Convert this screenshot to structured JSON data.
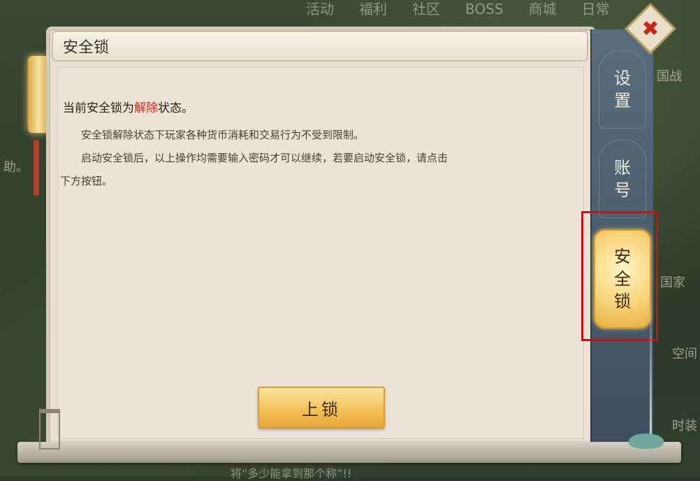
{
  "topnav": {
    "items": [
      "活动",
      "福利",
      "社区",
      "BOSS",
      "商城",
      "日常"
    ]
  },
  "background_labels": {
    "left": "助。",
    "right": [
      "国战",
      "国家",
      "空间",
      "时装"
    ]
  },
  "panel": {
    "title": "安全锁",
    "status_prefix": "当前安全锁为",
    "status_value": "解除",
    "status_suffix": "状态。",
    "paragraph1": "安全锁解除状态下玩家各种货币消耗和交易行为不受到限制。",
    "paragraph2": "启动安全锁后，以上操作均需要输入密码才可以继续，若要启动安全锁，请点击",
    "paragraph3": "下方按钮。",
    "lock_button": "上锁"
  },
  "tabs": [
    {
      "label_top": "设",
      "label_bottom": "置"
    },
    {
      "label_top": "账",
      "label_bottom": "号"
    },
    {
      "label_1": "安",
      "label_2": "全",
      "label_3": "锁",
      "active": true
    }
  ],
  "close_icon": "close-icon",
  "bottom_text": "将“多少能拿到那个称”!!",
  "colors": {
    "status_red": "#e0241b",
    "active_tab_gold": "#f8d47a",
    "highlight_red": "#c0141b"
  }
}
